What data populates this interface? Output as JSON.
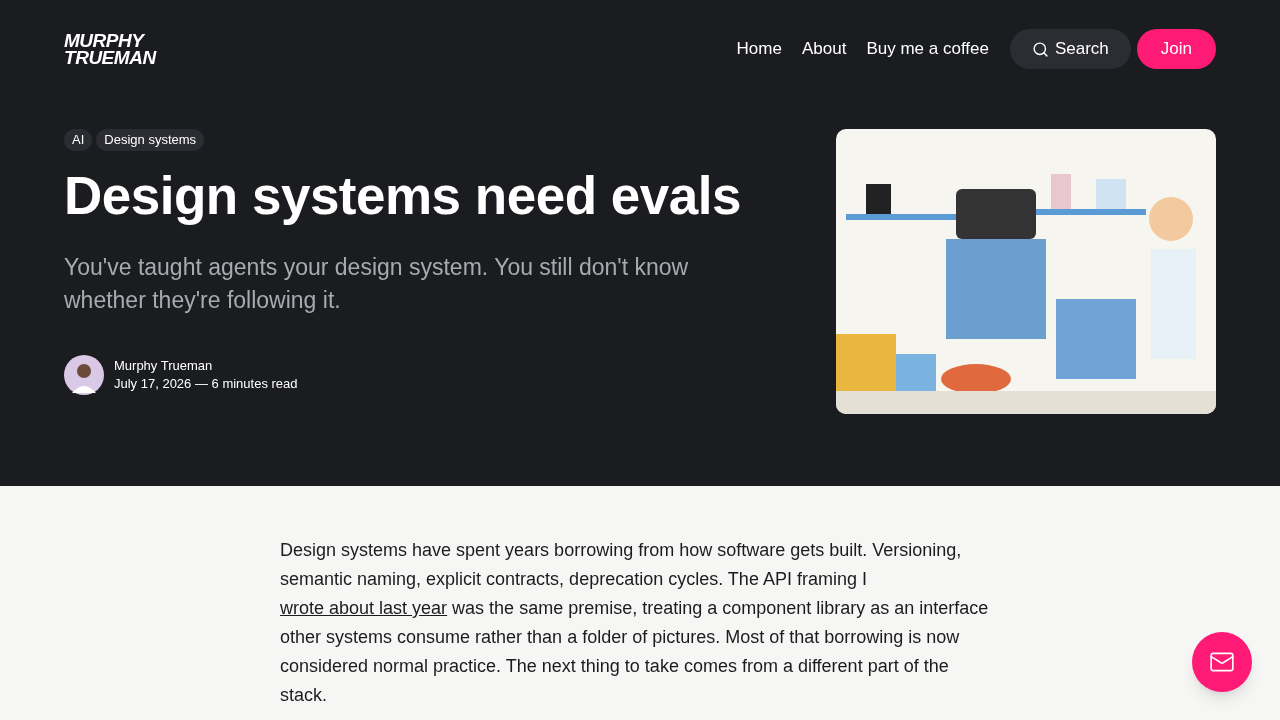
{
  "logo": [
    "MURPHY",
    "TRUEMAN"
  ],
  "nav": [
    "Home",
    "About",
    "Buy me a coffee"
  ],
  "search_button": "Search",
  "join_button": "Join",
  "tags": [
    "AI",
    "Design systems"
  ],
  "title": "Design systems need evals",
  "subtitle": "You've taught agents your design system. You still don't know whether they're following it.",
  "author": {
    "name": "Murphy Trueman",
    "meta": "July 17, 2026 — 6 minutes read"
  },
  "hero_image": {
    "kind": "picture"
  },
  "body": {
    "before": "Design systems have spent years borrowing from how software gets built. Versioning, semantic naming, explicit contracts, deprecation cycles. The API framing I ",
    "link": "wrote about last year",
    "after": " was the same premise, treating a component library as an interface other systems consume rather than a folder of pictures. Most of that borrowing is now considered normal practice. The next thing to take comes from a different part of the stack."
  }
}
